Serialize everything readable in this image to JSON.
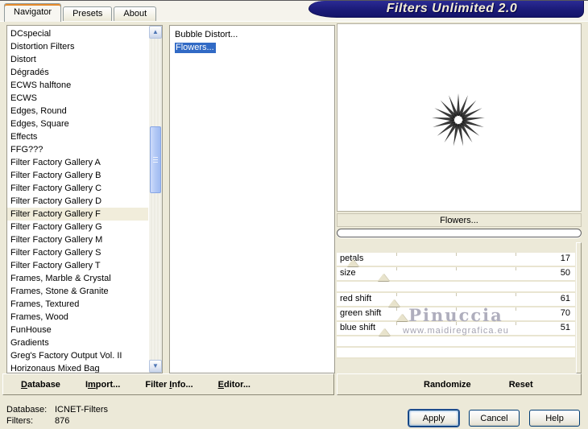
{
  "window": {
    "title": "Filters Unlimited 2.0"
  },
  "colors": {
    "dialog_bg": "#ECE9D8",
    "logo_navy": "#1B1B78",
    "selection_blue": "#316AC5",
    "selected_category_bg": "#F1EDDB",
    "active_tab_accent": "#E68B2C"
  },
  "tabs": [
    {
      "label": "Navigator",
      "active": true
    },
    {
      "label": "Presets",
      "active": false
    },
    {
      "label": "About",
      "active": false
    }
  ],
  "category_list": {
    "selected": "Filter Factory Gallery F",
    "items": [
      "DCspecial",
      "Distortion Filters",
      "Distort",
      "Dégradés",
      "ECWS halftone",
      "ECWS",
      "Edges, Round",
      "Edges, Square",
      "Effects",
      "FFG???",
      "Filter Factory Gallery A",
      "Filter Factory Gallery B",
      "Filter Factory Gallery C",
      "Filter Factory Gallery D",
      "Filter Factory Gallery F",
      "Filter Factory Gallery G",
      "Filter Factory Gallery M",
      "Filter Factory Gallery S",
      "Filter Factory Gallery T",
      "Frames, Marble & Crystal",
      "Frames, Stone & Granite",
      "Frames, Textured",
      "Frames, Wood",
      "FunHouse",
      "Gradients",
      "Greg's Factory Output Vol. II",
      "Horizonaus Mixed Bag"
    ]
  },
  "filter_list": {
    "selected": "Flowers...",
    "items": [
      "Bubble Distort...",
      "Flowers..."
    ]
  },
  "preview": {
    "header": "Flowers...",
    "progress_percent": 0
  },
  "sliders": {
    "max": 255,
    "rows": [
      {
        "label": "petals",
        "value": 17
      },
      {
        "label": "size",
        "value": 50
      },
      {
        "spacer": true
      },
      {
        "label": "red shift",
        "value": 61
      },
      {
        "label": "green shift",
        "value": 70
      },
      {
        "label": "blue shift",
        "value": 51
      },
      {
        "spacer": true
      },
      {
        "spacer": true
      }
    ]
  },
  "watermark": {
    "line1": "Pinuccia",
    "line2": "www.maidiregrafica.eu"
  },
  "toolbar_left": [
    {
      "name": "database",
      "pre": "",
      "key": "D",
      "post": "atabase"
    },
    {
      "name": "import",
      "pre": "I",
      "key": "m",
      "post": "port..."
    },
    {
      "name": "filter-info",
      "pre": "Filter ",
      "key": "I",
      "post": "nfo..."
    },
    {
      "name": "editor",
      "pre": "",
      "key": "E",
      "post": "ditor..."
    }
  ],
  "toolbar_right": [
    {
      "name": "randomize",
      "pre": "",
      "key": "",
      "post": "Randomize"
    },
    {
      "name": "reset",
      "pre": "",
      "key": "",
      "post": "Reset"
    }
  ],
  "status": {
    "database_label": "Database:",
    "database_value": "ICNET-Filters",
    "filters_label": "Filters:",
    "filters_value": "876"
  },
  "action_buttons": [
    {
      "name": "apply",
      "label": "Apply",
      "default": true
    },
    {
      "name": "cancel",
      "label": "Cancel",
      "default": false
    },
    {
      "name": "help",
      "label": "Help",
      "default": false
    }
  ]
}
